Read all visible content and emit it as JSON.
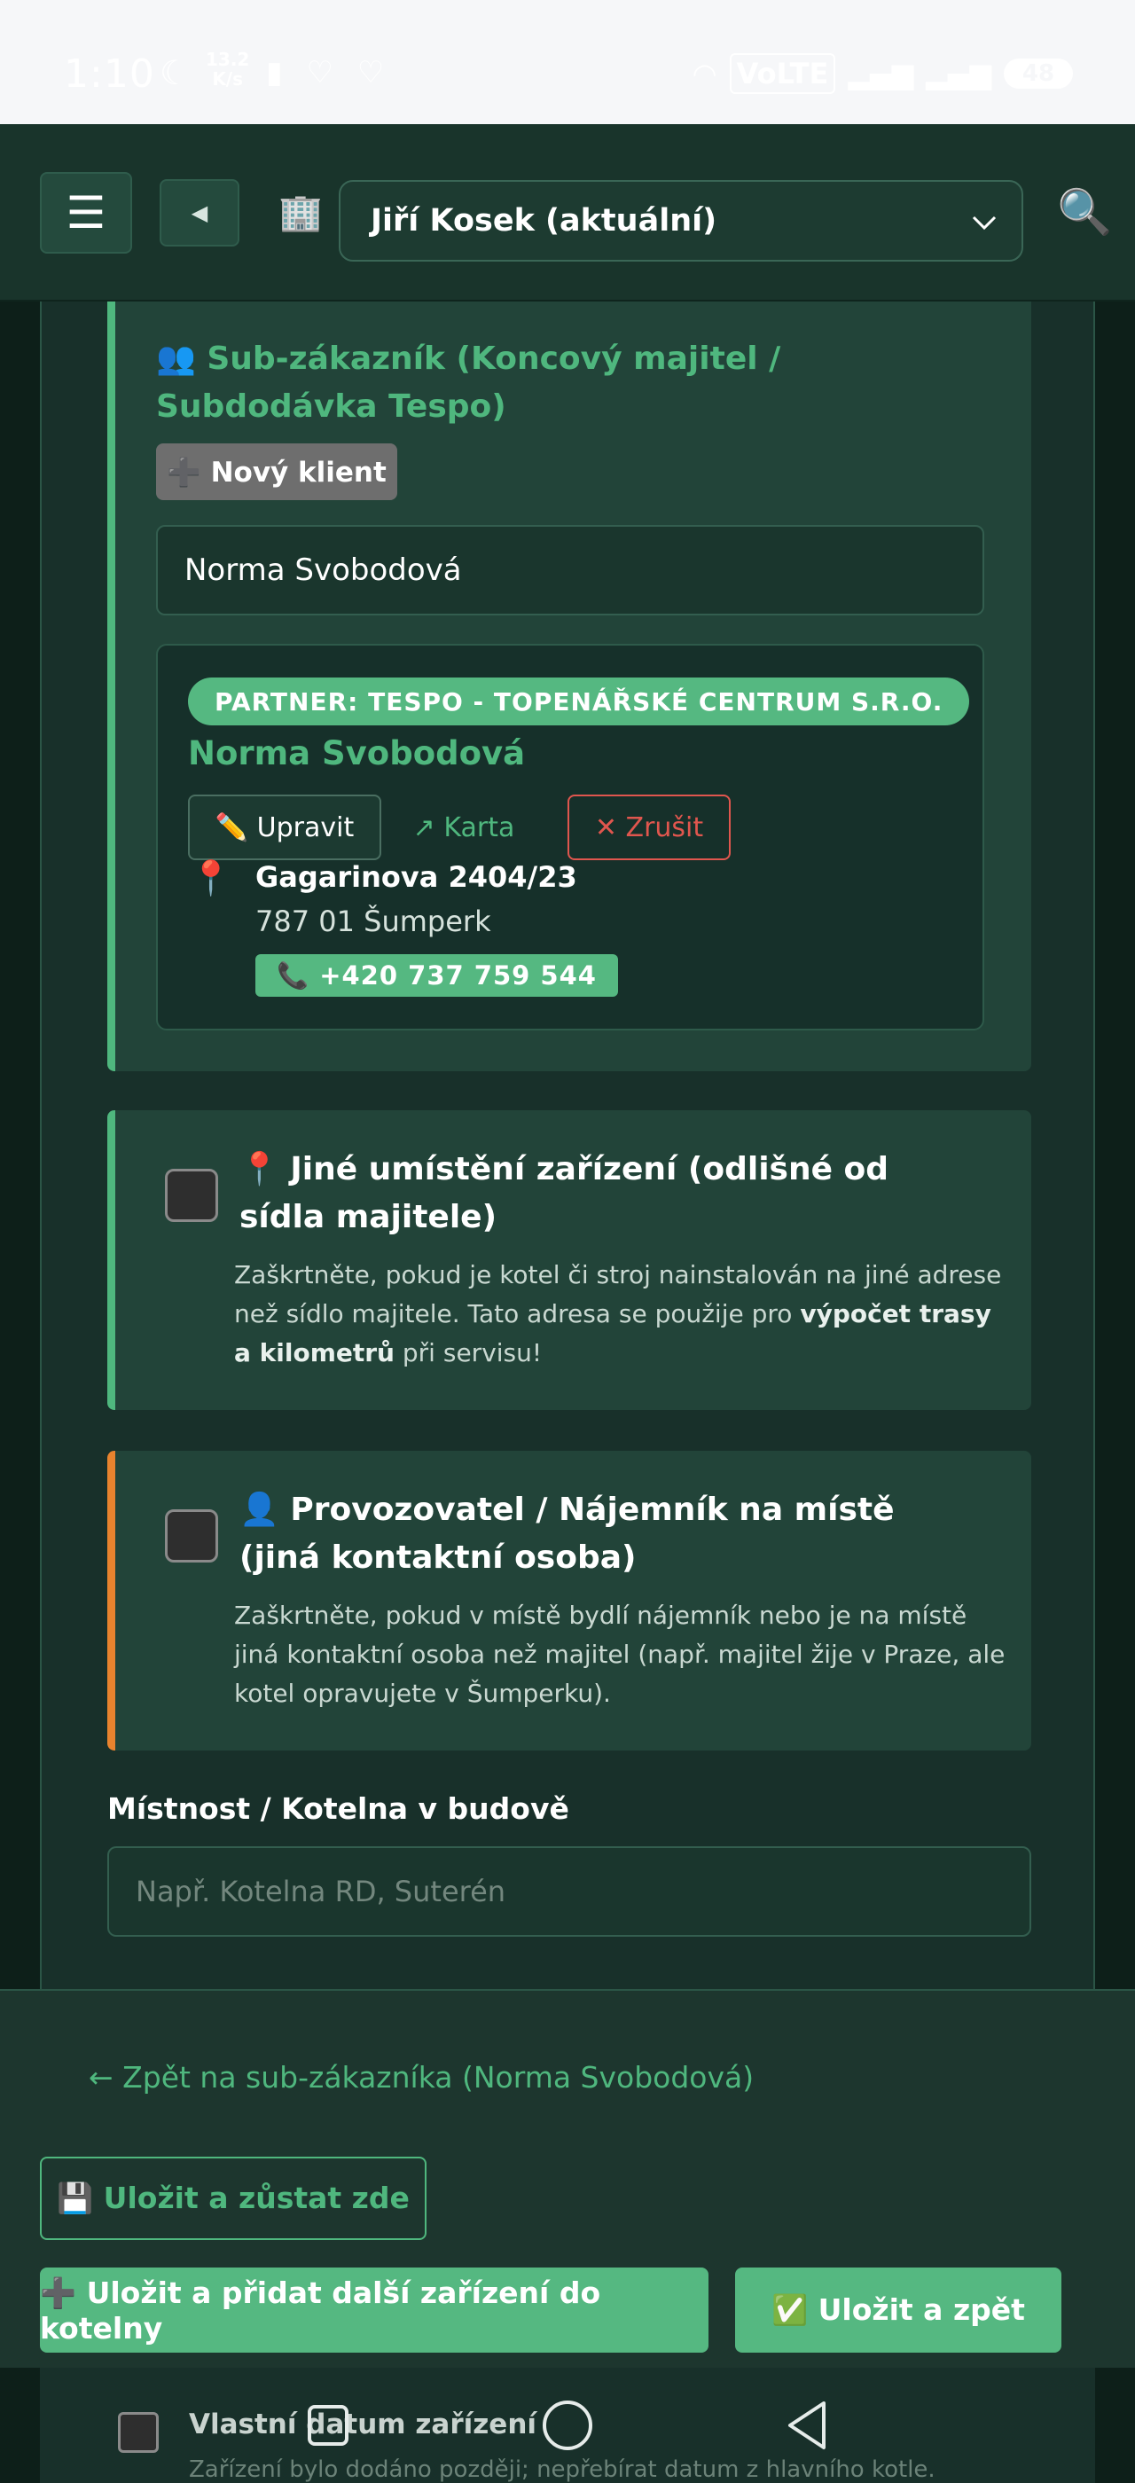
{
  "status_bar": {
    "time": "1:10",
    "net_speed_value": "13.2",
    "net_speed_unit": "K/s",
    "volte": "VoLTE",
    "battery": "48"
  },
  "header": {
    "menu_icon": "hamburger-icon",
    "back_icon": "triangle-left-icon",
    "building_icon": "building-icon",
    "technician_select": "Jiří Kosek (aktuální)",
    "search_icon": "search-icon"
  },
  "sub_customer": {
    "title": "👥 Sub-zákazník (Koncový majitel / Subdodávka Tespo)",
    "new_client_label": "➕ Nový klient",
    "client_value": "Norma Svobodová",
    "partner_badge": "PARTNER: TESPO - TOPENÁŘSKÉ CENTRUM S.R.O.",
    "name": "Norma Svobodová",
    "edit_label": "✏️ Upravit",
    "card_label": "↗ Karta",
    "cancel_label": "✕ Zrušit",
    "street": "Gagarinova 2404/23",
    "city": "787 01 Šumperk",
    "phone": "📞 +420 737 759 544"
  },
  "other_location": {
    "title": "📍 Jiné umístění zařízení (odlišné od sídla majitele)",
    "desc_before": "Zaškrtněte, pokud je kotel či stroj nainstalován na jiné adrese než sídlo majitele. Tato adresa se použije pro ",
    "desc_bold": "výpočet trasy a kilometrů",
    "desc_after": " při servisu!"
  },
  "operator": {
    "title": "👤 Provozovatel / Nájemník na místě (jiná kontaktní osoba)",
    "desc": "Zaškrtněte, pokud v místě bydlí nájemník nebo je na místě jiná kontaktní osoba než majitel (např. majitel žije v Praze, ale kotel opravujete v Šumperku)."
  },
  "room": {
    "label": "Místnost / Kotelna v budově",
    "placeholder": "Např. Kotelna RD, Suterén"
  },
  "footer": {
    "back_link": "← Zpět na sub-zákazníka (Norma Svobodová)",
    "save_stay": "💾 Uložit a zůstat zde",
    "save_add": "➕ Uložit a přidat další zařízení do kotelny",
    "save_back": "✅ Uložit a zpět"
  },
  "peek": {
    "title": "Vlastní datum zařízení",
    "desc": "Zařízení bylo dodáno později; nepřebírat datum z hlavního kotle."
  },
  "colors": {
    "accent_green": "#4fb77e",
    "warning_orange": "#e8832e",
    "danger_red": "#e0564e",
    "background": "#0d1f19"
  }
}
